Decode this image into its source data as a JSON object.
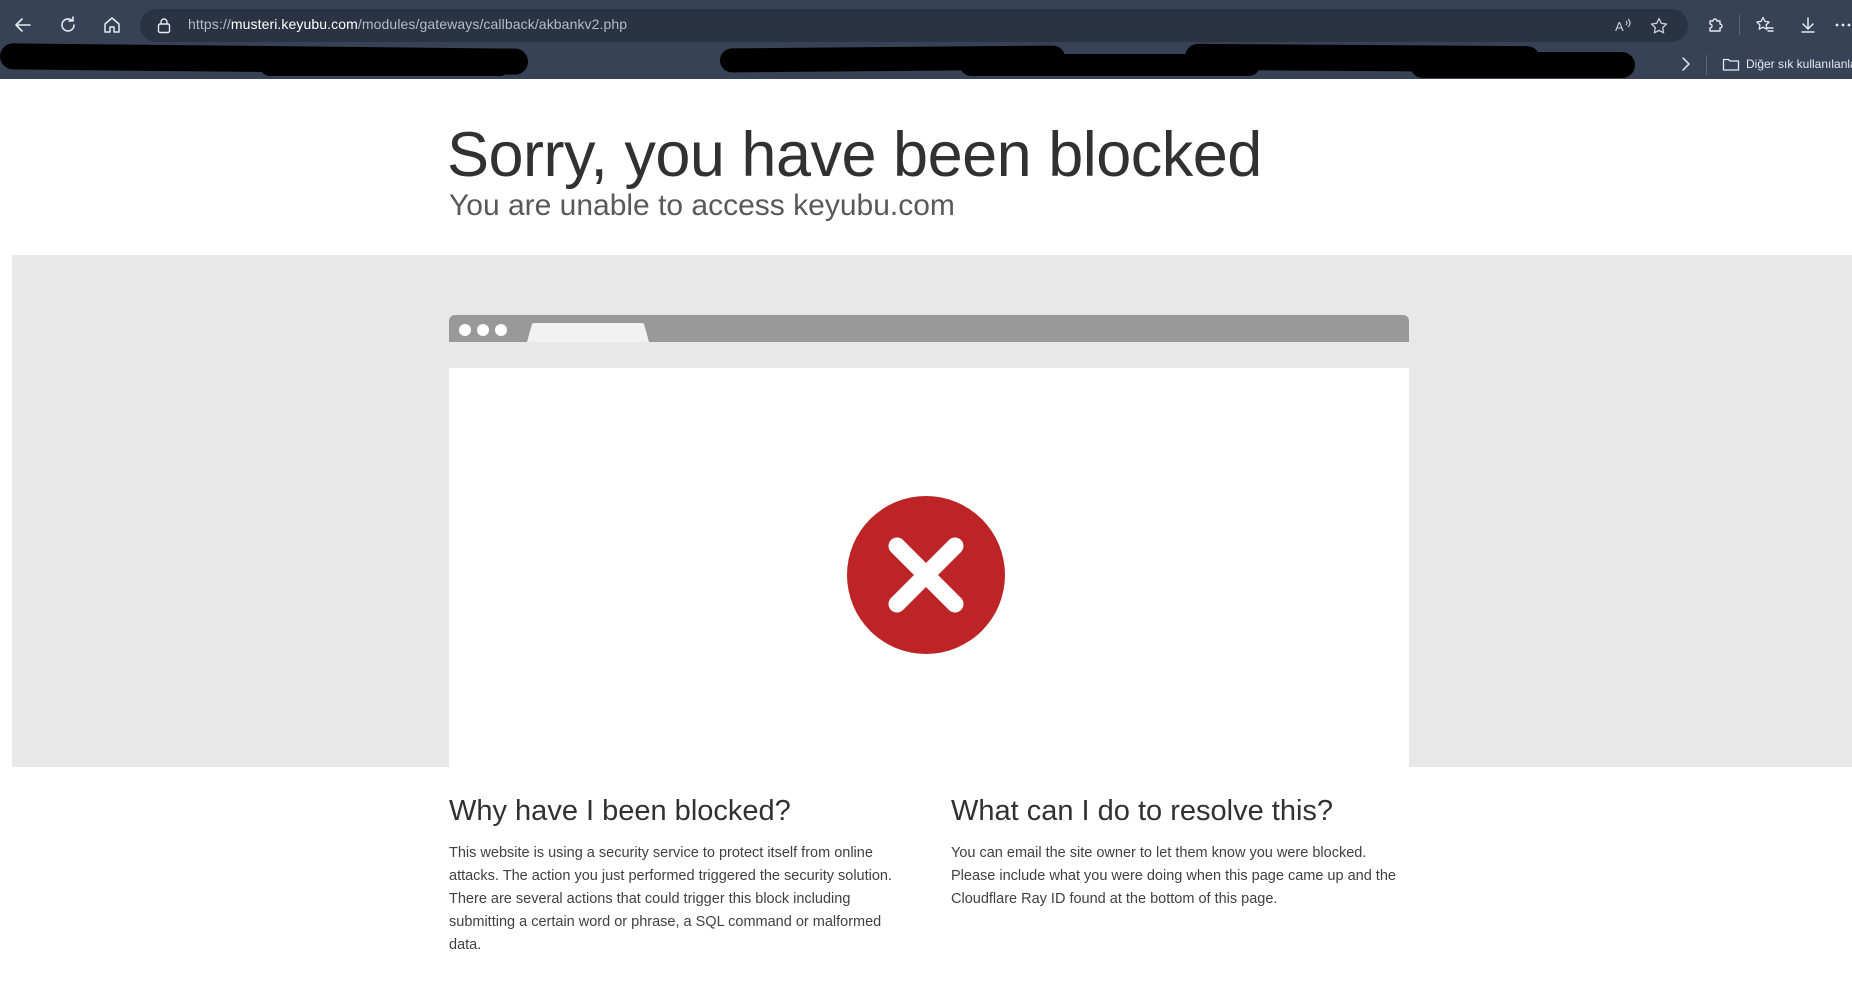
{
  "browser": {
    "url_prefix": "https://",
    "url_host": "musteri.keyubu.com",
    "url_path": "/modules/gateways/callback/akbankv2.php",
    "bookmarks_other_label": "Diğer sık kullanılanlar"
  },
  "page": {
    "title": "Sorry, you have been blocked",
    "subtitle": "You are unable to access keyubu.com",
    "why_heading": "Why have I been blocked?",
    "why_text": "This website is using a security service to protect itself from online attacks. The action you just performed triggered the security solution. There are several actions that could trigger this block including submitting a certain word or phrase, a SQL command or malformed data.",
    "resolve_heading": "What can I do to resolve this?",
    "resolve_text": "You can email the site owner to let them know you were blocked. Please include what you were doing when this page came up and the Cloudflare Ray ID found at the bottom of this page."
  },
  "colors": {
    "chrome": "#384256",
    "band": "#e8e8e8",
    "block_red": "#bd2426",
    "mock_bar": "#999999"
  },
  "icons": [
    "back-icon",
    "refresh-icon",
    "home-icon",
    "lock-icon",
    "read-aloud-icon",
    "favorite-star-icon",
    "extensions-icon",
    "favorites-icon",
    "download-icon",
    "more-icon",
    "chevron-right-icon",
    "folder-icon",
    "block-x-icon"
  ]
}
